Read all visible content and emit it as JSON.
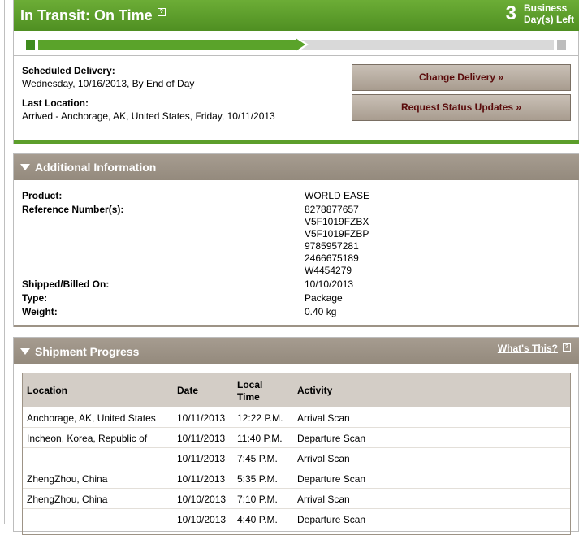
{
  "status": {
    "title": "In Transit: On Time",
    "help_glyph": "?",
    "days_left_number": "3",
    "days_left_label_1": "Business",
    "days_left_label_2": "Day(s) Left",
    "progress_fraction": 0.5
  },
  "delivery": {
    "scheduled_label": "Scheduled Delivery:",
    "scheduled_value": "Wednesday, 10/16/2013, By End of Day",
    "last_location_label": "Last Location:",
    "last_location_value": "Arrived - Anchorage, AK, United States, Friday, 10/11/2013"
  },
  "buttons": {
    "change_delivery": "Change Delivery »",
    "request_updates": "Request Status Updates »"
  },
  "additional_info": {
    "title": "Additional Information",
    "product_label": "Product:",
    "product_value": "WORLD EASE",
    "reference_label": "Reference Number(s):",
    "reference_values": [
      "8278877657",
      "V5F1019FZBX",
      "V5F1019FZBP",
      "9785957281",
      "2466675189",
      "W4454279"
    ],
    "shipped_label": "Shipped/Billed On:",
    "shipped_value": "10/10/2013",
    "type_label": "Type:",
    "type_value": "Package",
    "weight_label": "Weight:",
    "weight_value": "0.40 kg"
  },
  "shipment_progress": {
    "title": "Shipment Progress",
    "whats_this": "What's This?",
    "columns": {
      "location": "Location",
      "date": "Date",
      "local_time_1": "Local",
      "local_time_2": "Time",
      "activity": "Activity"
    },
    "rows": [
      {
        "location": "Anchorage, AK, United States",
        "date": "10/11/2013",
        "time": "12:22 P.M.",
        "activity": "Arrival Scan"
      },
      {
        "location": "Incheon, Korea, Republic of",
        "date": "10/11/2013",
        "time": "11:40 P.M.",
        "activity": "Departure Scan"
      },
      {
        "location": "",
        "date": "10/11/2013",
        "time": "7:45 P.M.",
        "activity": "Arrival Scan"
      },
      {
        "location": "ZhengZhou, China",
        "date": "10/11/2013",
        "time": "5:35 P.M.",
        "activity": "Departure Scan"
      },
      {
        "location": "ZhengZhou, China",
        "date": "10/10/2013",
        "time": "7:10 P.M.",
        "activity": "Arrival Scan"
      },
      {
        "location": "",
        "date": "10/10/2013",
        "time": "4:40 P.M.",
        "activity": "Departure Scan"
      }
    ]
  },
  "colors": {
    "brand_green": "#5c9e2b",
    "section_taupe": "#9d9386",
    "button_text": "#5a0b0b"
  }
}
